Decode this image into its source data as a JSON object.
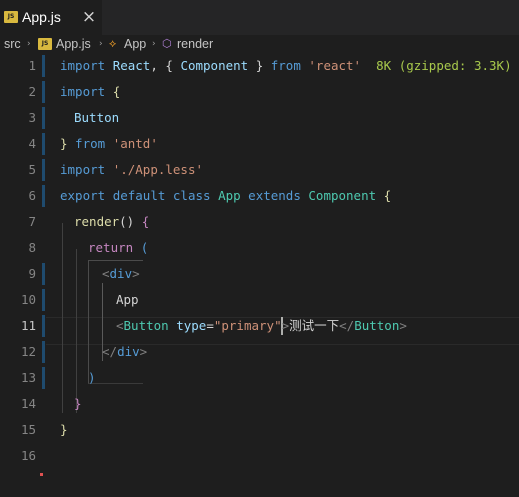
{
  "theme": {
    "background": "#1e1e1e",
    "tabbar_background": "#252526",
    "modified_band": "#1f4b6e",
    "added_band": "#587c0c",
    "keyword": "#569cd6",
    "control_keyword": "#c586c0",
    "string": "#ce9178",
    "class_name": "#4ec9b0",
    "function": "#dcdcaa",
    "variable": "#9cdcfe",
    "tag": "#808080",
    "jsx_component": "#4ec9b0",
    "text": "#d4d4d4",
    "import_cost": "#a8c94c"
  },
  "tab": {
    "icon": "js-file-icon",
    "icon_text": "JS",
    "label": "App.js",
    "close_icon": "close-icon",
    "close_glyph": "×"
  },
  "breadcrumb": {
    "folder": "src",
    "file_icon_text": "JS",
    "file": "App.js",
    "class_glyph": "⟡",
    "class_name": "App",
    "method_glyph": "⬡",
    "method": "render",
    "separator": "›"
  },
  "editor": {
    "active_line": 11,
    "lines": [
      {
        "num": "1",
        "change": "modified",
        "tokens": [
          {
            "t": "import ",
            "c": "keyword"
          },
          {
            "t": "React",
            "c": "variable"
          },
          {
            "t": ", { ",
            "c": "text"
          },
          {
            "t": "Component",
            "c": "variable"
          },
          {
            "t": " } ",
            "c": "text"
          },
          {
            "t": "from ",
            "c": "keyword"
          },
          {
            "t": "'react'",
            "c": "string"
          },
          {
            "t": "  8K (gzipped: 3.3K)",
            "c": "import_cost"
          }
        ]
      },
      {
        "num": "2",
        "change": "modified",
        "tokens": [
          {
            "t": "import ",
            "c": "keyword"
          },
          {
            "t": "{",
            "c": "function"
          }
        ]
      },
      {
        "num": "3",
        "change": "modified",
        "tokens": [
          {
            "t": "Button",
            "c": "variable"
          }
        ]
      },
      {
        "num": "4",
        "change": "modified",
        "tokens": [
          {
            "t": "}",
            "c": "function"
          },
          {
            "t": " from ",
            "c": "keyword"
          },
          {
            "t": "'antd'",
            "c": "string"
          }
        ]
      },
      {
        "num": "5",
        "change": "modified",
        "tokens": [
          {
            "t": "import ",
            "c": "keyword"
          },
          {
            "t": "'./App.less'",
            "c": "string"
          }
        ]
      },
      {
        "num": "6",
        "change": "modified",
        "tokens": [
          {
            "t": "export ",
            "c": "keyword"
          },
          {
            "t": "default ",
            "c": "keyword"
          },
          {
            "t": "class ",
            "c": "keyword"
          },
          {
            "t": "App ",
            "c": "class_name"
          },
          {
            "t": "extends ",
            "c": "keyword"
          },
          {
            "t": "Component ",
            "c": "class_name"
          },
          {
            "t": "{",
            "c": "function"
          }
        ]
      },
      {
        "num": "7",
        "change": "none",
        "tokens": [
          {
            "t": "render",
            "c": "function"
          },
          {
            "t": "() ",
            "c": "text"
          },
          {
            "t": "{",
            "c": "control_keyword"
          }
        ]
      },
      {
        "num": "8",
        "change": "none",
        "tokens": [
          {
            "t": "return ",
            "c": "control_keyword"
          },
          {
            "t": "(",
            "c": "keyword"
          }
        ]
      },
      {
        "num": "9",
        "change": "modified",
        "tokens": [
          {
            "t": "<",
            "c": "tag"
          },
          {
            "t": "div",
            "c": "keyword"
          },
          {
            "t": ">",
            "c": "tag"
          }
        ]
      },
      {
        "num": "10",
        "change": "modified",
        "tokens": [
          {
            "t": "App",
            "c": "text"
          }
        ]
      },
      {
        "num": "11",
        "change": "modified",
        "tokens": [
          {
            "t": "<",
            "c": "tag"
          },
          {
            "t": "Button ",
            "c": "jsx_component"
          },
          {
            "t": "type",
            "c": "variable"
          },
          {
            "t": "=",
            "c": "text"
          },
          {
            "t": "\"primary\"",
            "c": "string"
          },
          {
            "t": ">",
            "c": "tag"
          },
          {
            "t": "测试一下",
            "c": "text"
          },
          {
            "t": "</",
            "c": "tag"
          },
          {
            "t": "Button",
            "c": "jsx_component"
          },
          {
            "t": ">",
            "c": "tag"
          }
        ]
      },
      {
        "num": "12",
        "change": "modified",
        "tokens": [
          {
            "t": "</",
            "c": "tag"
          },
          {
            "t": "div",
            "c": "keyword"
          },
          {
            "t": ">",
            "c": "tag"
          }
        ]
      },
      {
        "num": "13",
        "change": "modified",
        "tokens": [
          {
            "t": ")",
            "c": "keyword"
          }
        ]
      },
      {
        "num": "14",
        "change": "none",
        "tokens": [
          {
            "t": "}",
            "c": "control_keyword"
          }
        ]
      },
      {
        "num": "15",
        "change": "none",
        "tokens": [
          {
            "t": "}",
            "c": "function"
          }
        ]
      },
      {
        "num": "16",
        "change": "none",
        "tokens": []
      }
    ]
  }
}
